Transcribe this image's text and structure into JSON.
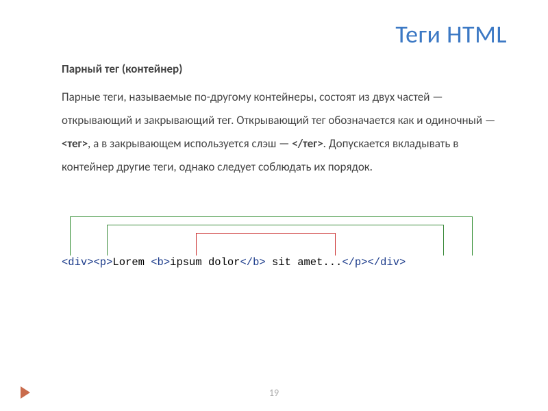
{
  "title": "Теги HTML",
  "subtitle": "Парный тег (контейнер)",
  "body_html": "Парные теги, называемые по-другому контейнеры, состоят из двух частей — открывающий и закрывающий тег. Открывающий тег обозначается как и одиночный — <b>&lt;тег&gt;</b>, а в закрывающем используется слэш — <b>&lt;/тег&gt;</b>. Допускается вкладывать в контейнер другие теги, однако следует соблюдать их порядок.",
  "code": {
    "t1": "<div><p>",
    "txt1": "Lorem ",
    "t2": "<b>",
    "txt2": "ipsum dolor",
    "t3": "</b>",
    "txt3": " sit amet...",
    "t4": "</p></div>"
  },
  "page": "19"
}
